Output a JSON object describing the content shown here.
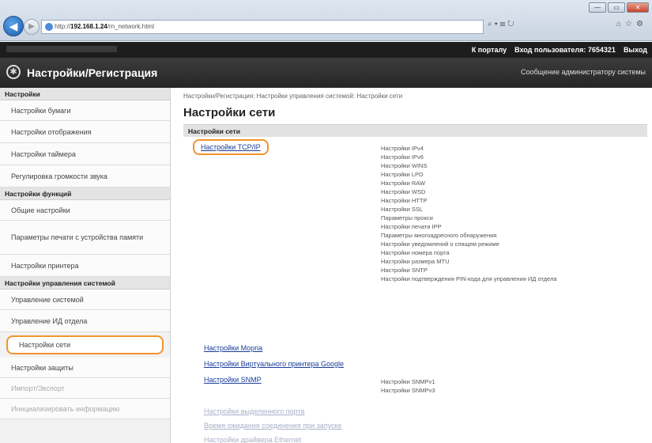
{
  "browser": {
    "url_prefix": "http://",
    "url_host": "192.168.1.24",
    "url_path": "/rn_network.html",
    "minimize": "—",
    "maximize": "▭",
    "close": "✕",
    "addr_tools": "⌕▾⊠↻",
    "right_tools": "⌂☆⚙"
  },
  "header": {
    "portal_link": "К порталу",
    "user_label": "Вход пользователя: 7654321",
    "logout": "Выход",
    "app_title": "Настройки/Регистрация",
    "admin_message": "Сообщение администратору системы"
  },
  "sidebar": {
    "groups": [
      {
        "title": "Настройки",
        "items": [
          "Настройки бумаги",
          "Настройки отображения",
          "Настройки таймера",
          "Регулировка громкости звука"
        ]
      },
      {
        "title": "Настройки функций",
        "items": [
          "Общие настройки",
          "Параметры печати с устройства памяти",
          "Настройки принтера"
        ]
      },
      {
        "title": "Настройки управления системой",
        "items": [
          "Управление системой",
          "Управление ИД отдела",
          "Настройки сети",
          "Настройки защиты",
          "Импорт/Экспорт",
          "Инициализировать информацию"
        ]
      }
    ]
  },
  "main": {
    "breadcrumb": "Настройки/Регистрация: Настройки управления системой: Настройки сети",
    "title": "Настройки сети",
    "section_title": "Настройки сети",
    "tcpip_link": "Настройки TCP/IP",
    "tcpip_subitems": [
      "Настройки IPv4",
      "Настройки IPv6",
      "Настройки WINS",
      "Настройки LPD",
      "Настройки RAW",
      "Настройки WSD",
      "Настройки HTTP",
      "Настройки SSL",
      "Параметры прокси",
      "Настройки печати IPP",
      "Параметры многоадресного обнаружения",
      "Настройки уведомлений о спящем режиме",
      "Настройки номера порта",
      "Настройки размера MTU",
      "Настройки SNTP",
      "Настройки подтверждения PIN-кода для управления ИД отдела"
    ],
    "mopria_link": "Настройки Mopria",
    "google_link": "Настройки Виртуального принтера Google",
    "snmp_link": "Настройки SNMP",
    "snmp_subitems": [
      "Настройки SNMPv1",
      "Настройки SNMPv3"
    ],
    "dedicated_port_link": "Настройки выделенного порта",
    "wait_time_link": "Время ожидания соединения при запуске",
    "ethernet_link": "Настройки драйвера Ethernet"
  }
}
